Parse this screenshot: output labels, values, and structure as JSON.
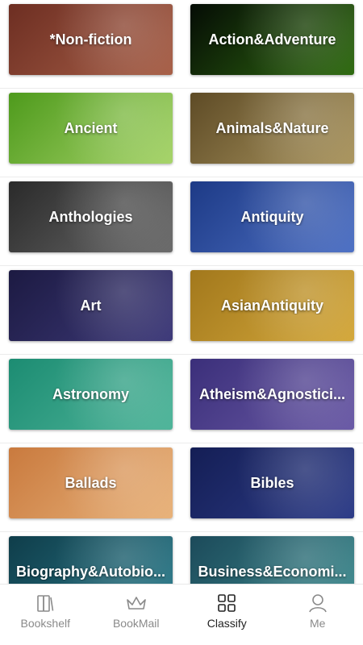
{
  "categories": [
    {
      "label": "*Non-fiction",
      "colors": [
        "#6d2e22",
        "#a86048"
      ]
    },
    {
      "label": "Action&Adventure",
      "colors": [
        "#050c05",
        "#2f6b10"
      ]
    },
    {
      "label": "Ancient",
      "colors": [
        "#4e9a1c",
        "#a7d46a"
      ]
    },
    {
      "label": "Animals&Nature",
      "colors": [
        "#5e4b26",
        "#ab965f"
      ]
    },
    {
      "label": "Anthologies",
      "colors": [
        "#2a2a2a",
        "#6b6b6b"
      ]
    },
    {
      "label": "Antiquity",
      "colors": [
        "#1d3a86",
        "#4d70c4"
      ]
    },
    {
      "label": "Art",
      "colors": [
        "#1c1a42",
        "#3e3a7a"
      ]
    },
    {
      "label": "AsianAntiquity",
      "colors": [
        "#a2781c",
        "#d4a83b"
      ]
    },
    {
      "label": "Astronomy",
      "colors": [
        "#1c8c72",
        "#4fb59a"
      ]
    },
    {
      "label": "Atheism&Agnostici...",
      "colors": [
        "#3b2f7a",
        "#6a5aa6"
      ]
    },
    {
      "label": "Ballads",
      "colors": [
        "#c97a3e",
        "#e8b27a"
      ]
    },
    {
      "label": "Bibles",
      "colors": [
        "#141e55",
        "#2d3c88"
      ]
    },
    {
      "label": "Biography&Autobio...",
      "colors": [
        "#0f3d4a",
        "#2a7a8a"
      ]
    },
    {
      "label": "Business&Economi...",
      "colors": [
        "#1c4a5a",
        "#3c8a8e"
      ]
    }
  ],
  "tabs": [
    {
      "label": "Bookshelf",
      "icon": "bookshelf-icon",
      "active": false
    },
    {
      "label": "BookMail",
      "icon": "crown-icon",
      "active": false
    },
    {
      "label": "Classify",
      "icon": "grid-icon",
      "active": true
    },
    {
      "label": "Me",
      "icon": "person-icon",
      "active": false
    }
  ],
  "colors": {
    "active_tab": "#222222",
    "inactive_tab": "#8a8a8a"
  }
}
